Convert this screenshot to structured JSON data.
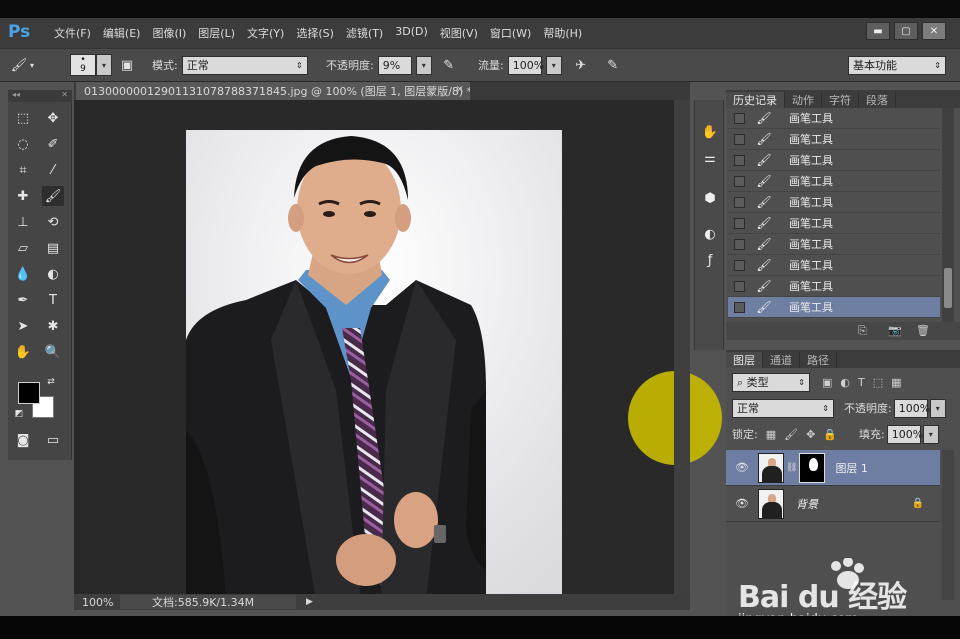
{
  "app": {
    "logo": "Ps"
  },
  "menu": [
    "文件(F)",
    "编辑(E)",
    "图像(I)",
    "图层(L)",
    "文字(Y)",
    "选择(S)",
    "滤镜(T)",
    "3D(D)",
    "视图(V)",
    "窗口(W)",
    "帮助(H)"
  ],
  "window_buttons": {
    "minimize": "▬",
    "maximize": "▢",
    "close": "✕"
  },
  "options": {
    "brush_size": "9",
    "mode_label": "模式:",
    "mode_value": "正常",
    "opacity_label": "不透明度:",
    "opacity_value": "9%",
    "flow_label": "流量:",
    "flow_value": "100%",
    "workspace": "基本功能"
  },
  "document": {
    "tab_title": "013000000129011310787883718​45.jpg @ 100% (图层 1, 图层蒙版/8) *",
    "tab_close": "×",
    "zoom": "100%",
    "doc_info": "文档:585.9K/1.34M"
  },
  "history_panel": {
    "tabs": [
      "历史记录",
      "动作",
      "字符",
      "段落"
    ],
    "items": [
      "画笔工具",
      "画笔工具",
      "画笔工具",
      "画笔工具",
      "画笔工具",
      "画笔工具",
      "画笔工具",
      "画笔工具",
      "画笔工具",
      "画笔工具"
    ]
  },
  "layers_panel": {
    "tabs": [
      "图层",
      "通道",
      "路径"
    ],
    "filter_label": "类型",
    "blend_mode": "正常",
    "opacity_label": "不透明度:",
    "opacity_value": "100%",
    "lock_label": "锁定:",
    "fill_label": "填充:",
    "fill_value": "100%",
    "layers": [
      {
        "name": "图层 1"
      },
      {
        "name": "背景"
      }
    ]
  },
  "watermark": {
    "brand": "Bai du 经验",
    "url": "jingyan.baidu.com"
  },
  "colors": {
    "accent_selection": "#6e7ea2",
    "cursor_highlight": "#c6b800",
    "ps_blue": "#4aa3e6"
  }
}
